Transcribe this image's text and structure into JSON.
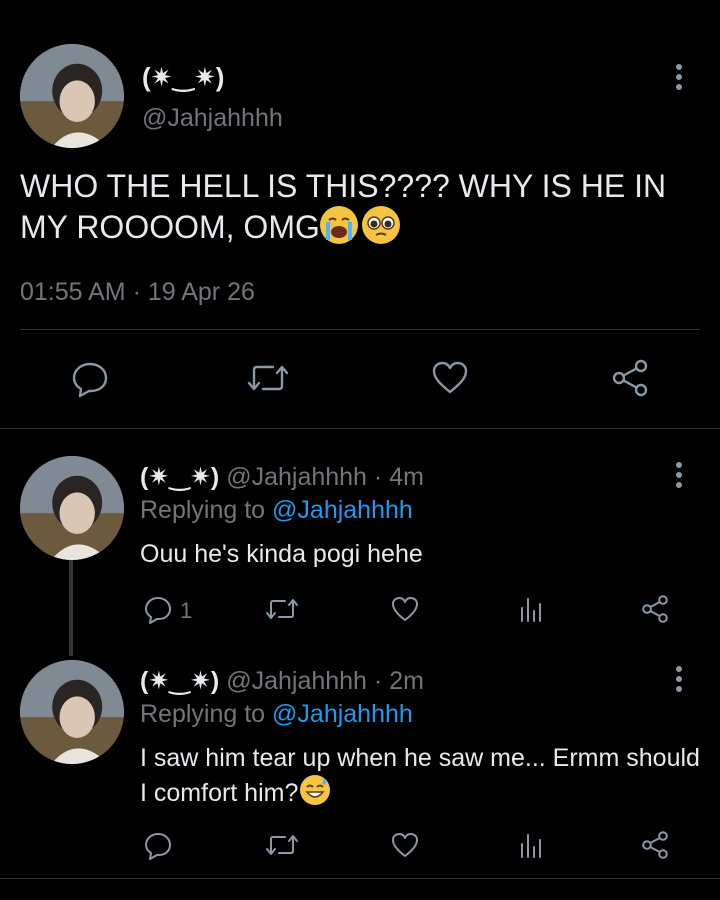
{
  "main_tweet": {
    "display_name": "(✷‿✷)",
    "handle": "@Jahjahhhh",
    "text": "WHO THE HELL IS THIS???? WHY IS HE IN MY ROOOOM, OMG",
    "timestamp": "01:55 AM · 19 Apr 26",
    "emojis": [
      "loudly-crying-face-emoji",
      "pleading-face-emoji"
    ]
  },
  "replies": [
    {
      "display_name": "(✷‿✷)",
      "handle": "@Jahjahhhh",
      "time": "· 4m",
      "replying_label": "Replying to",
      "replying_handle": "@Jahjahhhh",
      "text": "Ouu he's kinda pogi hehe",
      "reply_count": "1"
    },
    {
      "display_name": "(✷‿✷)",
      "handle": "@Jahjahhhh",
      "time": "· 2m",
      "replying_label": "Replying to",
      "replying_handle": "@Jahjahhhh",
      "text": "I saw him tear up when he saw me... Ermm should I comfort him?",
      "emoji": "grinning-sweat-face-emoji"
    }
  ],
  "colors": {
    "background": "#000000",
    "text": "#e7e9ea",
    "muted": "#71767b",
    "link": "#1d9bf0",
    "divider": "#2f3336"
  }
}
